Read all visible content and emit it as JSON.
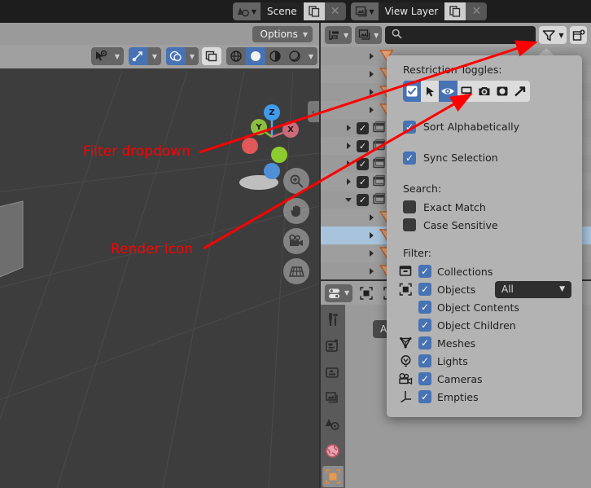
{
  "topbar": {
    "scene": {
      "icon": "scene-icon",
      "name": "Scene",
      "copy_icon": "duplicate-icon",
      "close_icon": "x-icon"
    },
    "view_layer": {
      "icon": "view-layer-icon",
      "name": "View Layer",
      "copy_icon": "duplicate-icon",
      "close_icon": "x-icon"
    }
  },
  "viewport": {
    "options_label": "Options",
    "gizmo": {
      "z": "Z",
      "y": "Y",
      "x": "X"
    },
    "nav_buttons": [
      "zoom-icon",
      "pan-hand-icon",
      "camera-view-icon",
      "perspective-toggle-icon"
    ],
    "header_tools": [
      "object-mode-icon",
      "transform-orientation-icon",
      "snap-magnet-icon",
      "proportional-edit-icon",
      "overlay-icon",
      "wireframe-shading-icon",
      "solid-shading-icon",
      "material-preview-icon",
      "rendered-shading-icon"
    ]
  },
  "outliner": {
    "display_mode_icon": "outliner-display-mode-icon",
    "filter_id_icon": "view-layer-icon",
    "search": {
      "placeholder": "",
      "value": "",
      "icon": "search-icon"
    },
    "filter_button_icon": "funnel-filter-icon",
    "new_collection_icon": "new-collection-icon",
    "rows": [
      {
        "type": "mesh",
        "indent": 3,
        "checked": null,
        "expand": "collapsed",
        "selected": false
      },
      {
        "type": "mesh",
        "indent": 3,
        "checked": null,
        "expand": "collapsed",
        "selected": false
      },
      {
        "type": "mesh",
        "indent": 3,
        "checked": null,
        "expand": "collapsed",
        "selected": false
      },
      {
        "type": "mesh",
        "indent": 3,
        "checked": null,
        "expand": "collapsed",
        "selected": false
      },
      {
        "type": "collection",
        "indent": 1,
        "checked": true,
        "expand": "collapsed",
        "selected": false
      },
      {
        "type": "collection",
        "indent": 1,
        "checked": true,
        "expand": "collapsed",
        "selected": false
      },
      {
        "type": "collection",
        "indent": 1,
        "checked": true,
        "expand": "collapsed",
        "selected": false
      },
      {
        "type": "collection",
        "indent": 1,
        "checked": true,
        "expand": "collapsed",
        "selected": false
      },
      {
        "type": "collection",
        "indent": 1,
        "checked": true,
        "expand": "expanded",
        "selected": false
      },
      {
        "type": "mesh",
        "indent": 3,
        "checked": null,
        "expand": "collapsed",
        "selected": false
      },
      {
        "type": "mesh",
        "indent": 3,
        "checked": null,
        "expand": "collapsed",
        "selected": true
      },
      {
        "type": "mesh",
        "indent": 3,
        "checked": null,
        "expand": "collapsed",
        "selected": false
      },
      {
        "type": "mesh",
        "indent": 3,
        "checked": null,
        "expand": "collapsed",
        "selected": false
      }
    ]
  },
  "filter_popup": {
    "restriction_title": "Restriction Toggles:",
    "restriction_toggles": [
      {
        "icon": "checkbox-enable-icon",
        "active": true
      },
      {
        "icon": "cursor-selectable-icon",
        "active": false
      },
      {
        "icon": "eye-hide-icon",
        "active": true
      },
      {
        "icon": "monitor-disable-viewport-icon",
        "active": false
      },
      {
        "icon": "camera-disable-render-icon",
        "active": false
      },
      {
        "icon": "holdout-icon",
        "active": false
      },
      {
        "icon": "indirect-only-icon",
        "active": false
      }
    ],
    "sort_alphabetically": {
      "label": "Sort Alphabetically",
      "checked": true
    },
    "sync_selection": {
      "label": "Sync Selection",
      "checked": true
    },
    "search_title": "Search:",
    "search_options": [
      {
        "label": "Exact Match",
        "checked": false
      },
      {
        "label": "Case Sensitive",
        "checked": false
      }
    ],
    "filter_title": "Filter:",
    "filter_items": [
      {
        "label": "Collections",
        "checked": true,
        "icon": "collection-box-icon",
        "dropdown": null
      },
      {
        "label": "Objects",
        "checked": true,
        "icon": "object-square-icon",
        "dropdown": "All"
      },
      {
        "label": "Object Contents",
        "checked": true,
        "icon": null,
        "dropdown": null
      },
      {
        "label": "Object Children",
        "checked": true,
        "icon": null,
        "dropdown": null
      },
      {
        "label": "Meshes",
        "checked": true,
        "icon": "mesh-triangle-icon",
        "dropdown": null
      },
      {
        "label": "Lights",
        "checked": true,
        "icon": "light-bulb-icon",
        "dropdown": null
      },
      {
        "label": "Cameras",
        "checked": true,
        "icon": "camera-icon",
        "dropdown": null
      },
      {
        "label": "Empties",
        "checked": true,
        "icon": "empty-axes-icon",
        "dropdown": null
      }
    ]
  },
  "properties": {
    "editor_type_icon": "properties-editor-icon",
    "header_icons": [
      "object-square-icon",
      "object-square-icon"
    ],
    "add_modifier_label": "Add M",
    "tabs": [
      {
        "name": "tool",
        "icon": "tool-wrench-icon",
        "active": false
      },
      {
        "name": "render",
        "icon": "render-camera-back-icon",
        "active": false
      },
      {
        "name": "output",
        "icon": "output-printer-icon",
        "active": false
      },
      {
        "name": "view-layer",
        "icon": "view-layer-images-icon",
        "active": false
      },
      {
        "name": "scene",
        "icon": "scene-cone-icon",
        "active": false
      },
      {
        "name": "world",
        "icon": "world-globe-icon",
        "active": false
      },
      {
        "name": "object",
        "icon": "object-orange-square-icon",
        "active": true
      }
    ]
  },
  "annotations": [
    {
      "text": "Filter dropdown",
      "color": "#ff0000"
    },
    {
      "text": "Render icon",
      "color": "#ff0000"
    }
  ],
  "colors": {
    "accent_blue": "#4772b3",
    "annotation_red": "#ff0000",
    "popup_bg": "#b3b3b3",
    "panel_bg": "#9a9a9a",
    "viewport_bg": "#3d3d3d",
    "topbar_bg": "#1d1d1d",
    "selected_row": "#a8c4dc",
    "mesh_orange": "#e8a273",
    "world_red": "#cc6a79"
  }
}
